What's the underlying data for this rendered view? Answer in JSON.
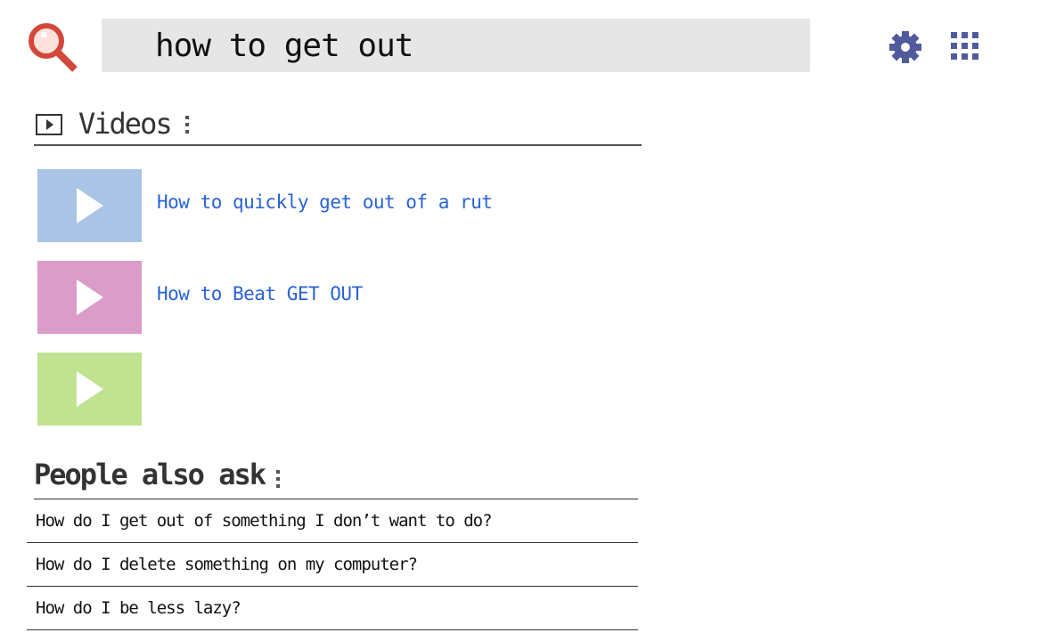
{
  "search": {
    "query": "how to get out"
  },
  "header": {
    "settings_icon": "gear-icon",
    "apps_icon": "apps-grid-icon",
    "logo_icon": "magnifier-icon"
  },
  "videos": {
    "title": "Videos",
    "items": [
      {
        "title": "How to quickly get out of a rut",
        "thumb_color": "#a9c4e4"
      },
      {
        "title": "How to Beat GET OUT",
        "thumb_color": "#dc9cca"
      },
      {
        "title": "",
        "thumb_color": "#c1e290"
      }
    ]
  },
  "people_also_ask": {
    "title": "People also ask",
    "questions": [
      "How do I get out of something I don’t want to do?",
      "How do I delete something on my computer?",
      "How do I be less lazy?"
    ]
  },
  "colors": {
    "accent_link": "#2a62d4",
    "icon_blue": "#4f5b9c",
    "logo_red": "#d4483c",
    "search_bar_bg": "#e6e6e6"
  }
}
